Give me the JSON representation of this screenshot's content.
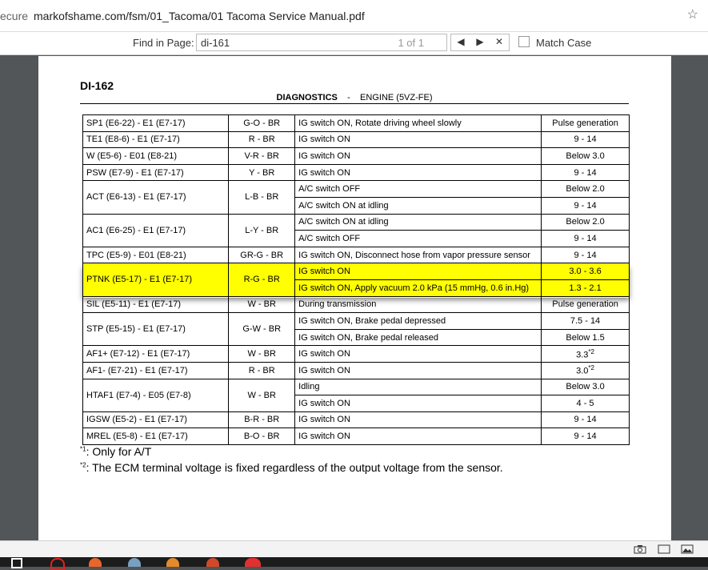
{
  "browser": {
    "secure_label": "ecure",
    "url": "markofshame.com/fsm/01_Tacoma/01 Tacoma Service Manual.pdf",
    "star_icon": "☆"
  },
  "find": {
    "label": "Find in Page:",
    "query": "di-161",
    "count": "1 of 1",
    "prev": "◀",
    "next": "▶",
    "close": "✕",
    "match_case": "Match Case"
  },
  "document": {
    "page_code": "DI-162",
    "section": "DIAGNOSTICS",
    "sep": "-",
    "subsection": "ENGINE (5VZ-FE)",
    "rows": [
      {
        "terminal": "SP1 (E6-22) - E1 (E7-17)",
        "wiring": "G-O  - BR",
        "condition": "IG switch ON, Rotate driving wheel slowly",
        "spec": "Pulse generation",
        "rowspan": 1
      },
      {
        "terminal": "TE1 (E8-6) - E1 (E7-17)",
        "wiring": "R  - BR",
        "condition": "IG switch ON",
        "spec": "9 - 14",
        "rowspan": 1
      },
      {
        "terminal": "W (E5-6) - E01 (E8-21)",
        "wiring": "V-R  - BR",
        "condition": "IG switch ON",
        "spec": "Below 3.0",
        "rowspan": 1
      },
      {
        "terminal": "PSW (E7-9) - E1 (E7-17)",
        "wiring": "Y  - BR",
        "condition": "IG switch ON",
        "spec": "9 - 14",
        "rowspan": 1
      },
      {
        "terminal": "ACT (E6-13) - E1 (E7-17)",
        "wiring": "L-B  - BR",
        "condition": "A/C switch OFF",
        "spec": "Below 2.0",
        "rowspan": 2
      },
      {
        "condition": "A/C switch ON at idling",
        "spec": "9 - 14",
        "cont": true
      },
      {
        "terminal": "AC1 (E6-25)  - E1 (E7-17)",
        "wiring": "L-Y  - BR",
        "condition": "A/C switch ON at idling",
        "spec": "Below 2.0",
        "rowspan": 2
      },
      {
        "condition": "A/C switch OFF",
        "spec": "9 - 14",
        "cont": true
      },
      {
        "terminal": "TPC (E5-9) - E01 (E8-21)",
        "wiring": "GR-G  - BR",
        "condition": "IG switch ON, Disconnect hose from vapor pressure sensor",
        "spec": "9 - 14",
        "rowspan": 1
      },
      {
        "terminal": "PTNK (E5-17) - E1 (E7-17)",
        "wiring": "R-G  - BR",
        "condition": "IG switch ON",
        "spec": "3.0 - 3.6",
        "rowspan": 2,
        "highlight": true
      },
      {
        "condition": "IG switch ON, Apply vacuum 2.0 kPa (15 mmHg, 0.6 in.Hg)",
        "spec": "1.3 - 2.1",
        "cont": true,
        "highlight": true
      },
      {
        "terminal": "SIL (E5-11) - E1 (E7-17)",
        "wiring": "W  - BR",
        "condition": "During transmission",
        "spec": "Pulse generation",
        "rowspan": 1
      },
      {
        "terminal": "STP (E5-15) - E1 (E7-17)",
        "wiring": "G-W  - BR",
        "condition": "IG switch ON, Brake pedal depressed",
        "spec": "7.5 - 14",
        "rowspan": 2
      },
      {
        "condition": "IG switch ON, Brake pedal released",
        "spec": "Below 1.5",
        "cont": true
      },
      {
        "terminal": "AF1+ (E7-12) - E1 (E7-17)",
        "wiring": "W  - BR",
        "condition": "IG switch ON",
        "spec": "3.3",
        "sup": "*2",
        "rowspan": 1
      },
      {
        "terminal": "AF1- (E7-21) - E1 (E7-17)",
        "wiring": "R  - BR",
        "condition": "IG switch ON",
        "spec": "3.0",
        "sup": "*2",
        "rowspan": 1
      },
      {
        "terminal": "HTAF1 (E7-4) - E05 (E7-8)",
        "wiring": "W  - BR",
        "condition": "Idling",
        "spec": "Below 3.0",
        "rowspan": 2
      },
      {
        "condition": "IG switch ON",
        "spec": "4 -  5",
        "cont": true
      },
      {
        "terminal": "IGSW (E5-2) - E1 (E7-17)",
        "wiring": "B-R  - BR",
        "condition": "IG switch ON",
        "spec": "9 - 14",
        "rowspan": 1
      },
      {
        "terminal": "MREL (E5-8) - E1 (E7-17)",
        "wiring": "B-O  - BR",
        "condition": "IG switch ON",
        "spec": "9 - 14",
        "rowspan": 1
      }
    ],
    "notes": [
      {
        "mark": "*1",
        "text": ": Only for A/T"
      },
      {
        "mark": "*2",
        "text": ": The ECM terminal voltage is fixed regardless of the output voltage from the sensor."
      }
    ]
  },
  "colors": {
    "highlight": "#ffff00",
    "viewer_bg": "#525659"
  },
  "status_icons": [
    "camera-icon",
    "page-icon",
    "image-icon"
  ]
}
